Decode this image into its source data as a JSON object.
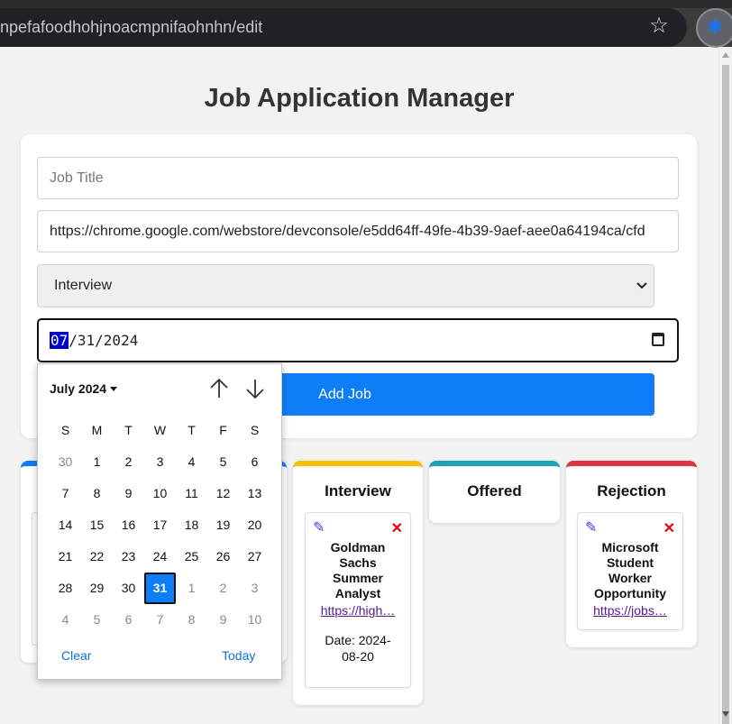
{
  "browser": {
    "url_text": "npefafoodhohjnoacmpnifaohnhn/edit",
    "star_icon": "star-icon",
    "extension_icon": "puzzle-icon"
  },
  "page": {
    "title": "Job Application Manager"
  },
  "form": {
    "job_title_placeholder": "Job Title",
    "job_url_value": "https://chrome.google.com/webstore/devconsole/e5dd64ff-49fe-4b39-9aef-aee0a64194ca/cfd",
    "status_value": "Interview",
    "date_month": "07",
    "date_rest": "/31/2024",
    "add_label": "Add Job"
  },
  "picker": {
    "month_label": "July 2024",
    "weekday_headers": [
      "S",
      "M",
      "T",
      "W",
      "T",
      "F",
      "S"
    ],
    "weeks": [
      [
        "30",
        "1",
        "2",
        "3",
        "4",
        "5",
        "6"
      ],
      [
        "7",
        "8",
        "9",
        "10",
        "11",
        "12",
        "13"
      ],
      [
        "14",
        "15",
        "16",
        "17",
        "18",
        "19",
        "20"
      ],
      [
        "21",
        "22",
        "23",
        "24",
        "25",
        "26",
        "27"
      ],
      [
        "28",
        "29",
        "30",
        "31",
        "1",
        "2",
        "3"
      ],
      [
        "4",
        "5",
        "6",
        "7",
        "8",
        "9",
        "10"
      ]
    ],
    "selected_day": "31",
    "clear_label": "Clear",
    "today_label": "Today"
  },
  "columns": {
    "interview": {
      "title": "Interview",
      "card": {
        "title": "Goldman Sachs Summer Analyst",
        "link": "https://high…",
        "date": "Date: 2024-08-20"
      }
    },
    "offered": {
      "title": "Offered"
    },
    "rejection": {
      "title": "Rejection",
      "card": {
        "title": "Microsoft Student Worker Opportunity",
        "link": "https://jobs…"
      }
    }
  },
  "colors": {
    "applied": "#0d7ef7",
    "interview": "#f5c000",
    "offered": "#1fa2b8",
    "rejection": "#dc3545",
    "primary_button": "#0d7ef7"
  }
}
